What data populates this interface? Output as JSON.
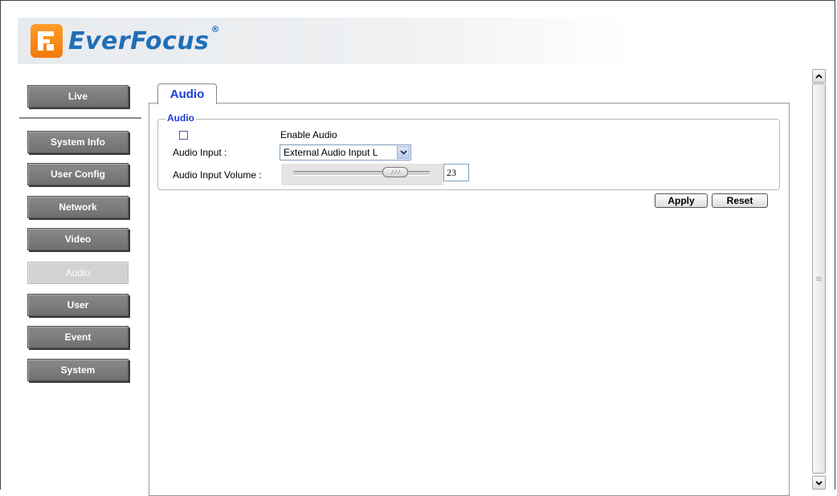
{
  "logo": {
    "text_ever": "Ever",
    "text_focus": "Focus",
    "reg_mark": "®",
    "mark_glyph": "F"
  },
  "nav": {
    "items": [
      {
        "label": "Live"
      },
      {
        "label": "System Info"
      },
      {
        "label": "User Config"
      },
      {
        "label": "Network"
      },
      {
        "label": "Video"
      },
      {
        "label": "Audio",
        "active": true
      },
      {
        "label": "User"
      },
      {
        "label": "Event"
      },
      {
        "label": "System"
      }
    ]
  },
  "tab": {
    "label": "Audio"
  },
  "audio_group": {
    "title": "Audio",
    "enable_label": "Enable Audio",
    "enable_checked": false,
    "input_label": "Audio Input :",
    "input_value": "External Audio Input L",
    "volume_label": "Audio Input Volume :",
    "volume_value": "23"
  },
  "actions": {
    "apply_label": "Apply",
    "reset_label": "Reset"
  },
  "colors": {
    "accent_blue": "#1a3ed8",
    "nav_button": "#7d7d7d",
    "nav_active": "#d2d2d2",
    "logo_orange": "#f07a0a",
    "logo_blue": "#1f6fb6"
  },
  "icons": {
    "select_arrow": "chevron-down-icon",
    "scroll_up": "arrow-up-icon",
    "scroll_down": "arrow-down-icon",
    "scroll_grip": "grip-icon"
  }
}
